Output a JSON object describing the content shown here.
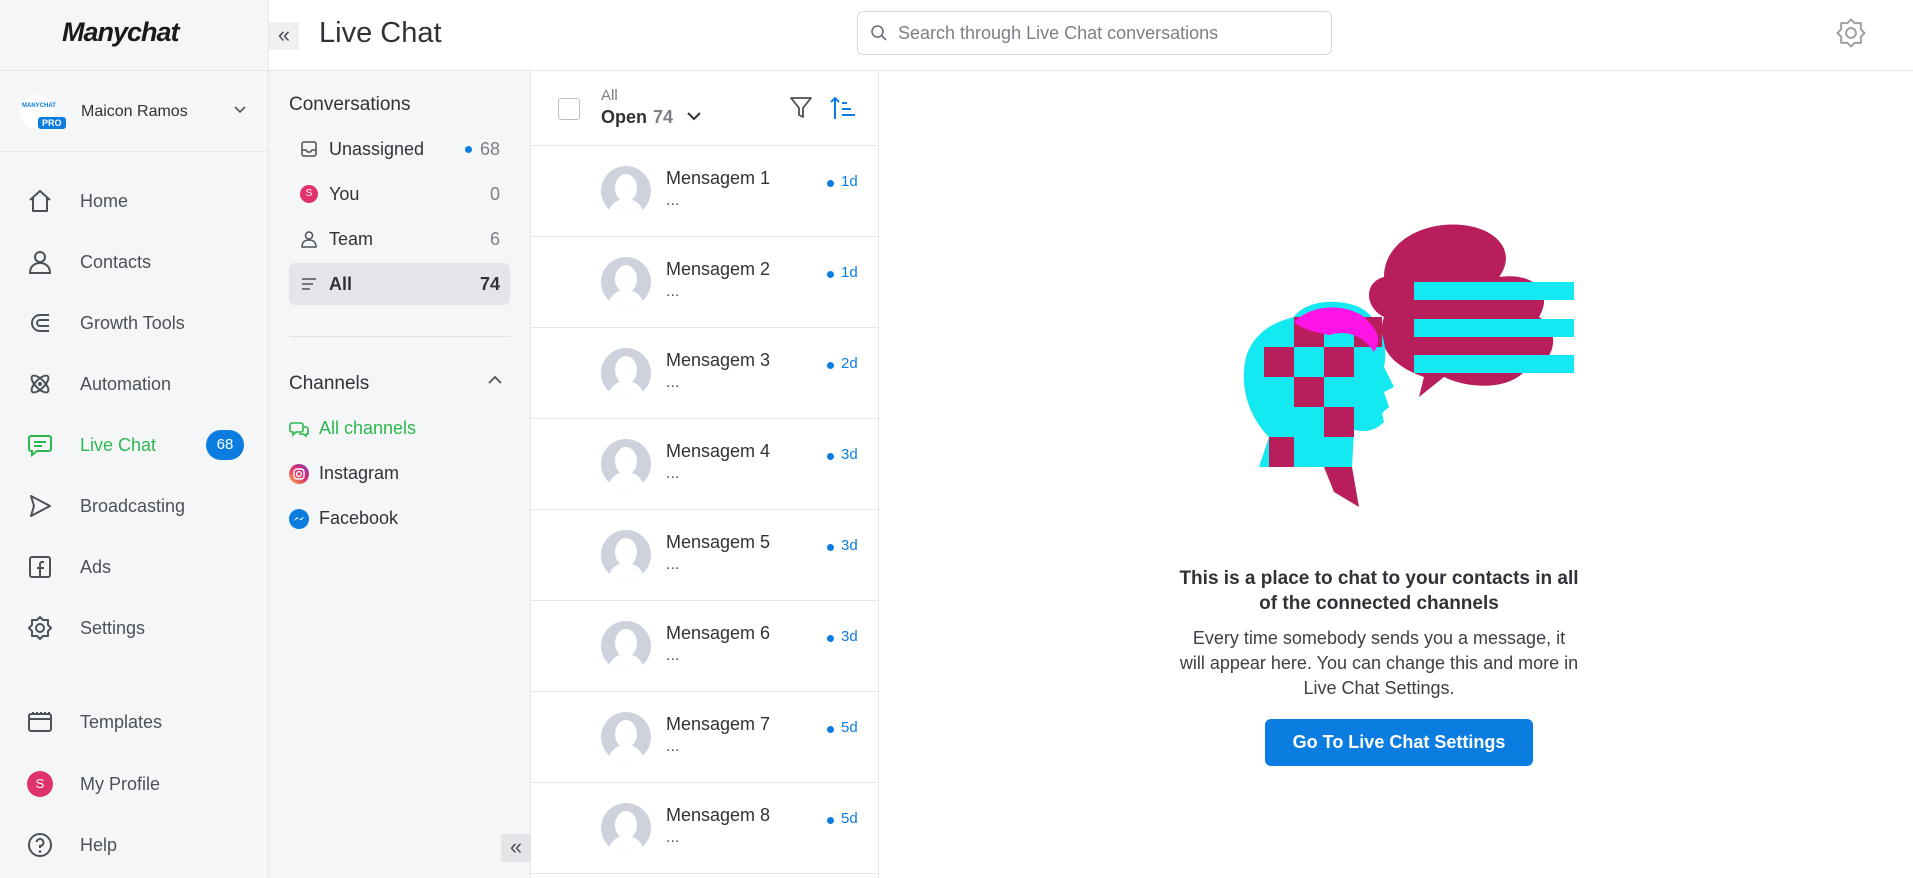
{
  "app": {
    "logo": "Manychat"
  },
  "account": {
    "name": "Maicon Ramos",
    "logo_text": "MANYCHAT",
    "plan_badge": "PRO"
  },
  "nav": {
    "items": [
      {
        "label": "Home",
        "icon": "home-icon"
      },
      {
        "label": "Contacts",
        "icon": "user-icon"
      },
      {
        "label": "Growth Tools",
        "icon": "magnet-icon"
      },
      {
        "label": "Automation",
        "icon": "automation-icon"
      },
      {
        "label": "Live Chat",
        "icon": "chat-icon",
        "badge": "68",
        "active": true
      },
      {
        "label": "Broadcasting",
        "icon": "send-icon"
      },
      {
        "label": "Ads",
        "icon": "facebook-icon"
      },
      {
        "label": "Settings",
        "icon": "gear-icon"
      },
      {
        "label": "Templates",
        "icon": "templates-icon"
      },
      {
        "label": "My Profile",
        "icon": "avatar",
        "avatar_letter": "S"
      },
      {
        "label": "Help",
        "icon": "help-icon"
      }
    ]
  },
  "header": {
    "title": "Live Chat",
    "search_placeholder": "Search through Live Chat conversations"
  },
  "conversations": {
    "title": "Conversations",
    "filters": [
      {
        "label": "Unassigned",
        "count": "68",
        "unread": true
      },
      {
        "label": "You",
        "count": "0",
        "avatar_letter": "S"
      },
      {
        "label": "Team",
        "count": "6"
      },
      {
        "label": "All",
        "count": "74",
        "active": true
      }
    ]
  },
  "channels": {
    "title": "Channels",
    "items": [
      {
        "label": "All channels",
        "active": true
      },
      {
        "label": "Instagram"
      },
      {
        "label": "Facebook"
      }
    ]
  },
  "message_list": {
    "status_caption": "All",
    "status": "Open",
    "status_count": "74",
    "messages": [
      {
        "name": "Mensagem 1",
        "preview": "...",
        "age": "1d"
      },
      {
        "name": "Mensagem 2",
        "preview": "...",
        "age": "1d"
      },
      {
        "name": "Mensagem 3",
        "preview": "...",
        "age": "2d"
      },
      {
        "name": "Mensagem 4",
        "preview": "...",
        "age": "3d"
      },
      {
        "name": "Mensagem 5",
        "preview": "...",
        "age": "3d"
      },
      {
        "name": "Mensagem 6",
        "preview": "...",
        "age": "3d"
      },
      {
        "name": "Mensagem 7",
        "preview": "...",
        "age": "5d"
      },
      {
        "name": "Mensagem 8",
        "preview": "...",
        "age": "5d"
      }
    ]
  },
  "empty_state": {
    "title": "This is a place to chat to your contacts in all of the connected channels",
    "text": "Every time somebody sends you a message, it will appear here. You can change this and more in Live Chat Settings.",
    "button": "Go To Live Chat Settings"
  },
  "colors": {
    "accent": "#0b7de0",
    "active_green": "#2db84f",
    "illustration_magenta": "#b81d5c",
    "illustration_cyan": "#14e8f0",
    "illustration_pink": "#ff14e6"
  }
}
